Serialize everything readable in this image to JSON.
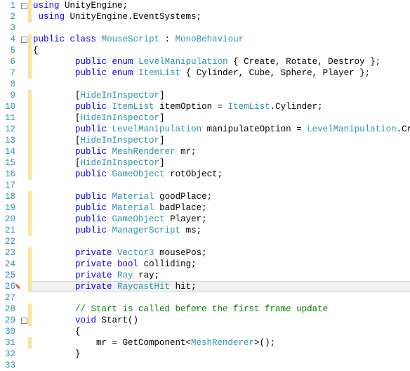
{
  "lines": [
    {
      "n": 1,
      "fold": "minus",
      "change": "mod",
      "tokens": [
        [
          "kw",
          "using"
        ],
        [
          "id",
          " UnityEngine;"
        ]
      ]
    },
    {
      "n": 2,
      "fold": "",
      "change": "mod",
      "tokens": [
        [
          "id",
          " "
        ],
        [
          "kw",
          "using"
        ],
        [
          "id",
          " UnityEngine.EventSystems;"
        ]
      ]
    },
    {
      "n": 3,
      "fold": "",
      "change": "",
      "tokens": []
    },
    {
      "n": 4,
      "fold": "minus",
      "change": "mod",
      "tokens": [
        [
          "kw",
          "public"
        ],
        [
          "id",
          " "
        ],
        [
          "kw",
          "class"
        ],
        [
          "id",
          " "
        ],
        [
          "type",
          "MouseScript"
        ],
        [
          "id",
          " : "
        ],
        [
          "type",
          "MonoBehaviour"
        ]
      ]
    },
    {
      "n": 5,
      "fold": "",
      "change": "mod",
      "tokens": [
        [
          "id",
          "{"
        ]
      ]
    },
    {
      "n": 6,
      "fold": "",
      "change": "mod",
      "tokens": [
        [
          "id",
          "        "
        ],
        [
          "kw",
          "public"
        ],
        [
          "id",
          " "
        ],
        [
          "kw",
          "enum"
        ],
        [
          "id",
          " "
        ],
        [
          "type",
          "LevelManipulation"
        ],
        [
          "id",
          " { Create, Rotate, Destroy };"
        ]
      ]
    },
    {
      "n": 7,
      "fold": "",
      "change": "mod",
      "tokens": [
        [
          "id",
          "        "
        ],
        [
          "kw",
          "public"
        ],
        [
          "id",
          " "
        ],
        [
          "kw",
          "enum"
        ],
        [
          "id",
          " "
        ],
        [
          "type",
          "ItemList"
        ],
        [
          "id",
          " { Cylinder, Cube, Sphere, Player };"
        ]
      ]
    },
    {
      "n": 8,
      "fold": "",
      "change": "",
      "tokens": []
    },
    {
      "n": 9,
      "fold": "",
      "change": "mod",
      "tokens": [
        [
          "id",
          "        ["
        ],
        [
          "type",
          "HideInInspector"
        ],
        [
          "id",
          "]"
        ]
      ]
    },
    {
      "n": 10,
      "fold": "",
      "change": "mod",
      "tokens": [
        [
          "id",
          "        "
        ],
        [
          "kw",
          "public"
        ],
        [
          "id",
          " "
        ],
        [
          "type",
          "ItemList"
        ],
        [
          "id",
          " itemOption = "
        ],
        [
          "type",
          "ItemList"
        ],
        [
          "id",
          ".Cylinder;"
        ]
      ]
    },
    {
      "n": 11,
      "fold": "",
      "change": "mod",
      "tokens": [
        [
          "id",
          "        ["
        ],
        [
          "type",
          "HideInInspector"
        ],
        [
          "id",
          "]"
        ]
      ]
    },
    {
      "n": 12,
      "fold": "",
      "change": "mod",
      "tokens": [
        [
          "id",
          "        "
        ],
        [
          "kw",
          "public"
        ],
        [
          "id",
          " "
        ],
        [
          "type",
          "LevelManipulation"
        ],
        [
          "id",
          " manipulateOption = "
        ],
        [
          "type",
          "LevelManipulation"
        ],
        [
          "id",
          ".Create;"
        ]
      ]
    },
    {
      "n": 13,
      "fold": "",
      "change": "mod",
      "tokens": [
        [
          "id",
          "        ["
        ],
        [
          "type",
          "HideInInspector"
        ],
        [
          "id",
          "]"
        ]
      ]
    },
    {
      "n": 14,
      "fold": "",
      "change": "mod",
      "tokens": [
        [
          "id",
          "        "
        ],
        [
          "kw",
          "public"
        ],
        [
          "id",
          " "
        ],
        [
          "type",
          "MeshRenderer"
        ],
        [
          "id",
          " mr;"
        ]
      ]
    },
    {
      "n": 15,
      "fold": "",
      "change": "mod",
      "tokens": [
        [
          "id",
          "        ["
        ],
        [
          "type",
          "HideInInspector"
        ],
        [
          "id",
          "]"
        ]
      ]
    },
    {
      "n": 16,
      "fold": "",
      "change": "mod",
      "tokens": [
        [
          "id",
          "        "
        ],
        [
          "kw",
          "public"
        ],
        [
          "id",
          " "
        ],
        [
          "type",
          "GameObject"
        ],
        [
          "id",
          " rotObject;"
        ]
      ]
    },
    {
      "n": 17,
      "fold": "",
      "change": "",
      "tokens": []
    },
    {
      "n": 18,
      "fold": "",
      "change": "mod",
      "tokens": [
        [
          "id",
          "        "
        ],
        [
          "kw",
          "public"
        ],
        [
          "id",
          " "
        ],
        [
          "type",
          "Material"
        ],
        [
          "id",
          " goodPlace;"
        ]
      ]
    },
    {
      "n": 19,
      "fold": "",
      "change": "mod",
      "tokens": [
        [
          "id",
          "        "
        ],
        [
          "kw",
          "public"
        ],
        [
          "id",
          " "
        ],
        [
          "type",
          "Material"
        ],
        [
          "id",
          " badPlace;"
        ]
      ]
    },
    {
      "n": 20,
      "fold": "",
      "change": "mod",
      "tokens": [
        [
          "id",
          "        "
        ],
        [
          "kw",
          "public"
        ],
        [
          "id",
          " "
        ],
        [
          "type",
          "GameObject"
        ],
        [
          "id",
          " Player;"
        ]
      ]
    },
    {
      "n": 21,
      "fold": "",
      "change": "mod",
      "tokens": [
        [
          "id",
          "        "
        ],
        [
          "kw",
          "public"
        ],
        [
          "id",
          " "
        ],
        [
          "type",
          "ManagerScript"
        ],
        [
          "id",
          " ms;"
        ]
      ]
    },
    {
      "n": 22,
      "fold": "",
      "change": "",
      "tokens": []
    },
    {
      "n": 23,
      "fold": "",
      "change": "mod",
      "tokens": [
        [
          "id",
          "        "
        ],
        [
          "kw",
          "private"
        ],
        [
          "id",
          " "
        ],
        [
          "type",
          "Vector3"
        ],
        [
          "id",
          " mousePos;"
        ]
      ]
    },
    {
      "n": 24,
      "fold": "",
      "change": "mod",
      "tokens": [
        [
          "id",
          "        "
        ],
        [
          "kw",
          "private"
        ],
        [
          "id",
          " "
        ],
        [
          "kw",
          "bool"
        ],
        [
          "id",
          " colliding;"
        ]
      ]
    },
    {
      "n": 25,
      "fold": "",
      "change": "mod",
      "tokens": [
        [
          "id",
          "        "
        ],
        [
          "kw",
          "private"
        ],
        [
          "id",
          " "
        ],
        [
          "type",
          "Ray"
        ],
        [
          "id",
          " ray;"
        ]
      ]
    },
    {
      "n": 26,
      "fold": "",
      "change": "mod",
      "hl": true,
      "pin": true,
      "tokens": [
        [
          "id",
          "        "
        ],
        [
          "kw",
          "private"
        ],
        [
          "id",
          " "
        ],
        [
          "type",
          "RaycastHit"
        ],
        [
          "id",
          " hit;"
        ]
      ]
    },
    {
      "n": 27,
      "fold": "",
      "change": "",
      "tokens": []
    },
    {
      "n": 28,
      "fold": "",
      "change": "mod",
      "tokens": [
        [
          "id",
          "        "
        ],
        [
          "cmt",
          "// Start is called before the first frame update"
        ]
      ]
    },
    {
      "n": 29,
      "fold": "minus",
      "change": "mod",
      "tokens": [
        [
          "id",
          "        "
        ],
        [
          "kw",
          "void"
        ],
        [
          "id",
          " Start()"
        ]
      ]
    },
    {
      "n": 30,
      "fold": "",
      "change": "",
      "tokens": [
        [
          "id",
          "        {"
        ]
      ]
    },
    {
      "n": 31,
      "fold": "",
      "change": "mod",
      "tokens": [
        [
          "id",
          "            mr = GetComponent<"
        ],
        [
          "type",
          "MeshRenderer"
        ],
        [
          "id",
          ">();"
        ]
      ]
    },
    {
      "n": 32,
      "fold": "",
      "change": "",
      "tokens": [
        [
          "id",
          "        }"
        ]
      ]
    },
    {
      "n": 33,
      "fold": "",
      "change": "",
      "tokens": []
    }
  ]
}
